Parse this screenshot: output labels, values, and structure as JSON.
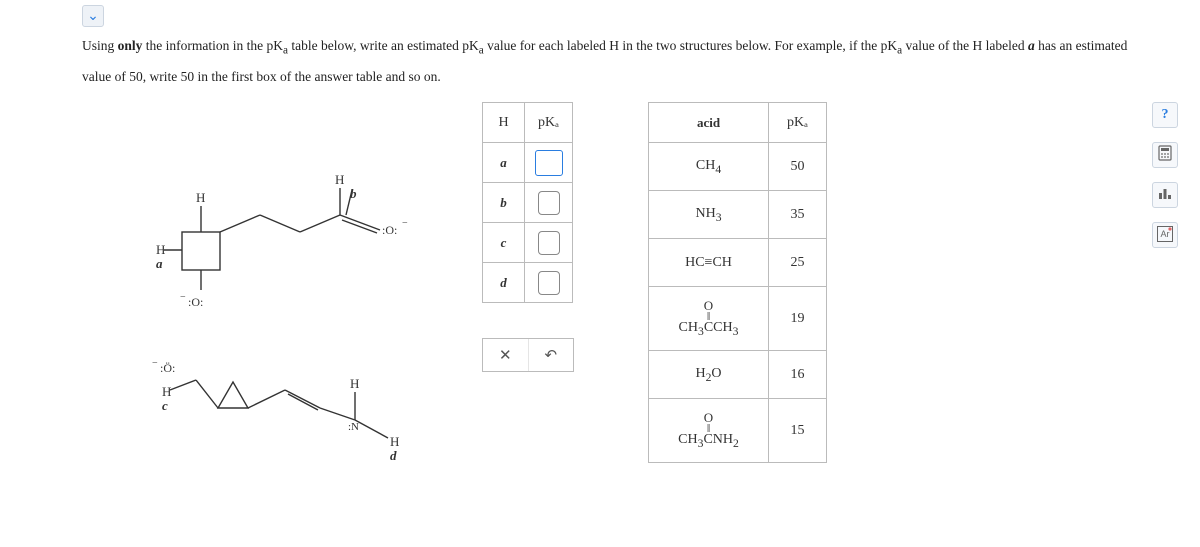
{
  "collapse_icon": "⌄",
  "question_html": "Using <b>only</b> the information in the pK<sub>a</sub> table below, write an estimated pK<sub>a</sub> value for each labeled H in the two structures below. For example, if the pK<sub>a</sub> value of the H labeled <b><i>a</i></b> has an estimated value of 50, write 50 in the first box of the answer table and so on.",
  "answer_table": {
    "header_h": "H",
    "header_pka": "pKₐ",
    "rows": [
      {
        "label": "a",
        "value": "",
        "active": true
      },
      {
        "label": "b",
        "value": "",
        "active": false
      },
      {
        "label": "c",
        "value": "",
        "active": false
      },
      {
        "label": "d",
        "value": "",
        "active": false
      }
    ]
  },
  "actions": {
    "clear": "✕",
    "reset": "↶"
  },
  "ref_table": {
    "header_acid": "acid",
    "header_pka": "pKₐ",
    "rows": [
      {
        "acid_html": "CH<sub>4</sub>",
        "pka": "50",
        "cls": "med"
      },
      {
        "acid_html": "NH<sub>3</sub>",
        "pka": "35",
        "cls": "med"
      },
      {
        "acid_html": "HC≡CH",
        "pka": "25",
        "cls": "med"
      },
      {
        "acid_html": "<span class='carbonyl-block'><span class='carbonyl-o'>O</span><span class='carbonyl-bond'>‖</span>CH<sub>3</sub>CCH<sub>3</sub></span>",
        "pka": "19",
        "cls": "tall"
      },
      {
        "acid_html": "H<sub>2</sub>O",
        "pka": "16",
        "cls": "med"
      },
      {
        "acid_html": "<span class='carbonyl-block'><span class='carbonyl-o'>O</span><span class='carbonyl-bond'>‖</span>CH<sub>3</sub>CNH<sub>2</sub></span>",
        "pka": "15",
        "cls": "tall"
      }
    ]
  },
  "tools": {
    "help": "?",
    "calc": "⌨",
    "bar": "₀▯₀",
    "ar": "Ar"
  },
  "structure_labels": {
    "h": "H",
    "a": "a",
    "b": "b",
    "c": "c",
    "d": "d",
    "o_neg": ":O:⁻",
    "o_neg2": ":Ö:⁻",
    "n": "N"
  }
}
